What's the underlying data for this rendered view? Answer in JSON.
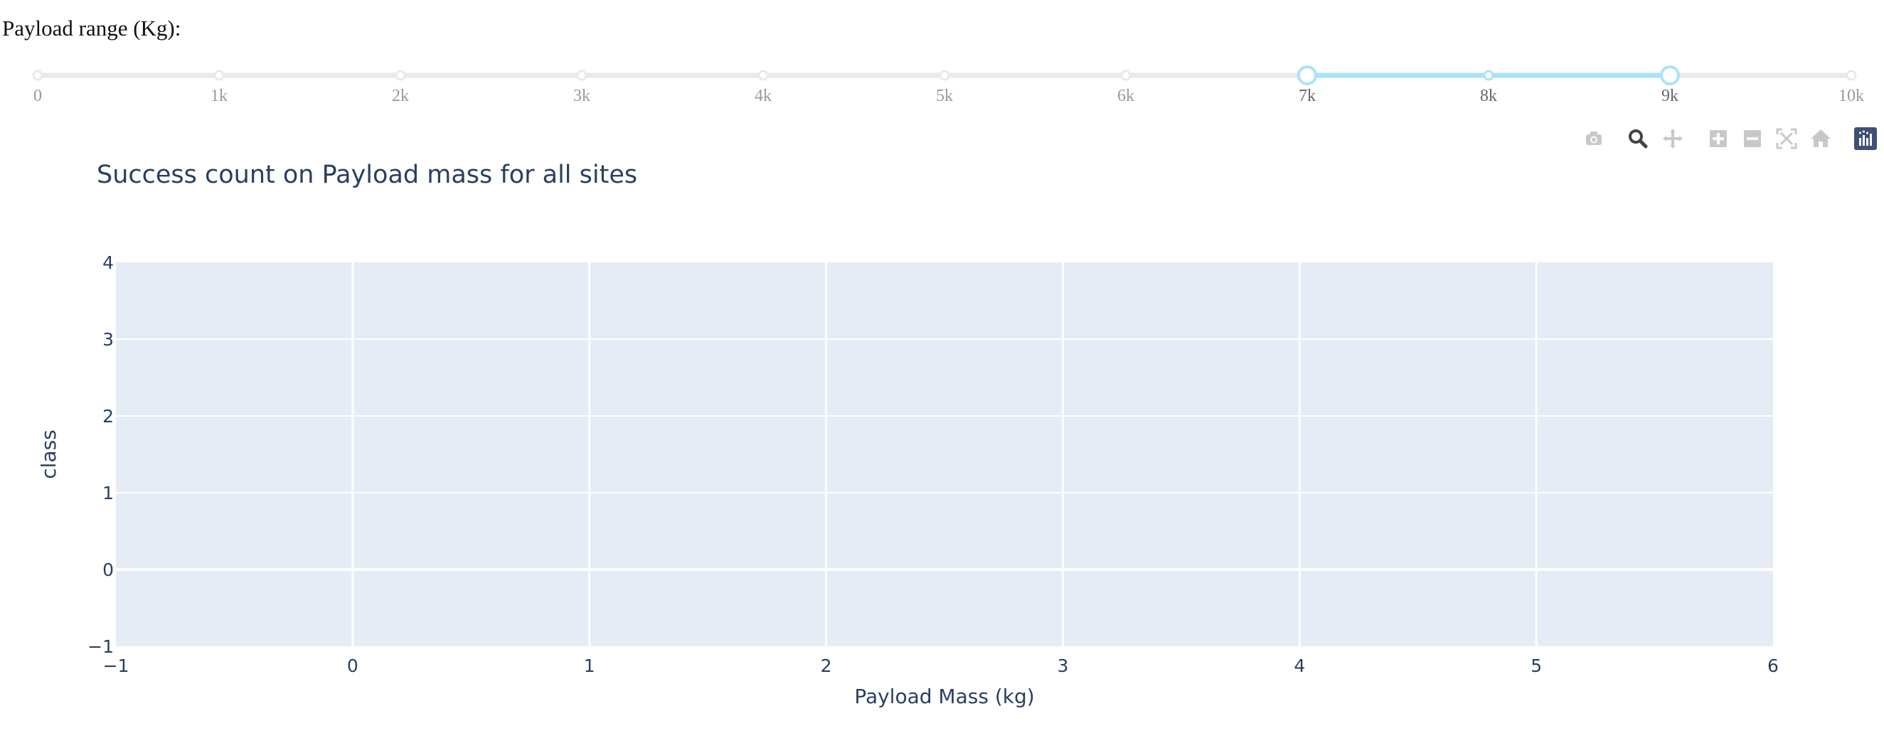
{
  "slider": {
    "label": "Payload range (Kg):",
    "min": 0,
    "max": 10000,
    "marks": [
      {
        "value": 0,
        "label": "0"
      },
      {
        "value": 1000,
        "label": "1k"
      },
      {
        "value": 2000,
        "label": "2k"
      },
      {
        "value": 3000,
        "label": "3k"
      },
      {
        "value": 4000,
        "label": "4k"
      },
      {
        "value": 5000,
        "label": "5k"
      },
      {
        "value": 6000,
        "label": "6k"
      },
      {
        "value": 7000,
        "label": "7k"
      },
      {
        "value": 8000,
        "label": "8k"
      },
      {
        "value": 9000,
        "label": "9k"
      },
      {
        "value": 10000,
        "label": "10k"
      }
    ],
    "selected": [
      7000,
      9000
    ],
    "track_color": "#e9e9e9",
    "active_color": "#abe2fb"
  },
  "modebar": {
    "buttons": [
      {
        "name": "camera-icon"
      },
      {
        "name": "zoom-icon"
      },
      {
        "name": "pan-icon"
      },
      {
        "name": "zoom-in-icon"
      },
      {
        "name": "zoom-out-icon"
      },
      {
        "name": "autoscale-icon"
      },
      {
        "name": "reset-axes-icon"
      },
      {
        "name": "plotly-logo-icon"
      }
    ]
  },
  "chart_data": {
    "type": "scatter",
    "title": "Success count on Payload mass for all sites",
    "xlabel": "Payload Mass (kg)",
    "ylabel": "class",
    "xlim": [
      -1,
      6
    ],
    "ylim": [
      -1,
      4
    ],
    "x_ticks": [
      -1,
      0,
      1,
      2,
      3,
      4,
      5,
      6
    ],
    "x_tick_labels": [
      "−1",
      "0",
      "1",
      "2",
      "3",
      "4",
      "5",
      "6"
    ],
    "y_ticks": [
      -1,
      0,
      1,
      2,
      3,
      4
    ],
    "y_tick_labels": [
      "−1",
      "0",
      "1",
      "2",
      "3",
      "4"
    ],
    "series": [],
    "grid": true,
    "plot_bg": "#e5ecf6",
    "text_color": "#2a3f5f"
  }
}
